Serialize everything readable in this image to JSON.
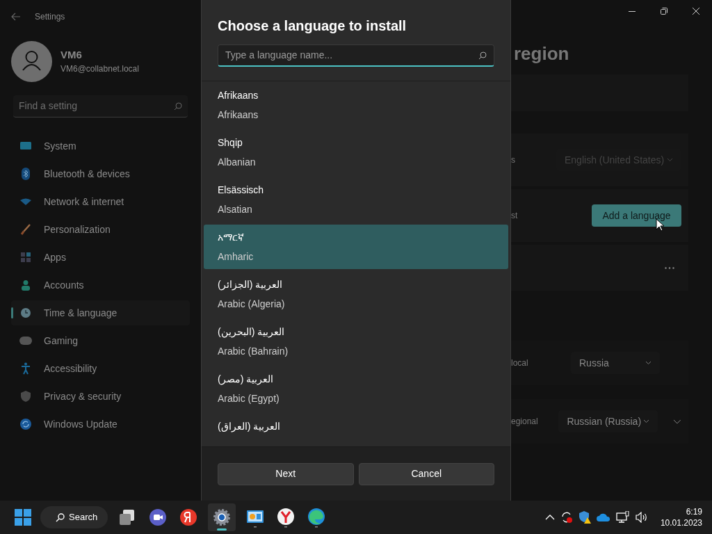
{
  "settings_window": {
    "title": "Settings",
    "user": {
      "name": "VM6",
      "email": "VM6@collabnet.local"
    },
    "search": {
      "placeholder": "Find a setting"
    },
    "sidebar": {
      "items": [
        {
          "label": "System",
          "selected": false
        },
        {
          "label": "Bluetooth & devices",
          "selected": false
        },
        {
          "label": "Network & internet",
          "selected": false
        },
        {
          "label": "Personalization",
          "selected": false
        },
        {
          "label": "Apps",
          "selected": false
        },
        {
          "label": "Accounts",
          "selected": false
        },
        {
          "label": "Time & language",
          "selected": true
        },
        {
          "label": "Gaming",
          "selected": false
        },
        {
          "label": "Accessibility",
          "selected": false
        },
        {
          "label": "Privacy & security",
          "selected": false
        },
        {
          "label": "Windows Update",
          "selected": false
        }
      ]
    },
    "page_title": "region",
    "language_rows": [
      {
        "label": "s",
        "dropdown": "English (United States)",
        "disabled": true
      },
      {
        "label": "st",
        "button": "Add a language"
      }
    ],
    "region_rows": [
      {
        "label": "local",
        "dropdown": "Russia"
      },
      {
        "label": "egional",
        "dropdown": "Russian (Russia)"
      }
    ]
  },
  "dialog": {
    "title": "Choose a language to install",
    "search": {
      "placeholder": "Type a language name..."
    },
    "languages": [
      {
        "native": "Afrikaans",
        "english": "Afrikaans",
        "selected": false
      },
      {
        "native": "Shqip",
        "english": "Albanian",
        "selected": false
      },
      {
        "native": "Elsässisch",
        "english": "Alsatian",
        "selected": false
      },
      {
        "native": "አማርኛ",
        "english": "Amharic",
        "selected": true
      },
      {
        "native": "العربية (الجزائر)",
        "english": "Arabic (Algeria)",
        "selected": false
      },
      {
        "native": "العربية (البحرين)",
        "english": "Arabic (Bahrain)",
        "selected": false
      },
      {
        "native": "العربية (مصر)",
        "english": "Arabic (Egypt)",
        "selected": false
      },
      {
        "native": "العربية (العراق)",
        "selected": false
      }
    ],
    "buttons": [
      "Next",
      "Cancel"
    ]
  },
  "taskbar": {
    "search": "Search",
    "time": "6:19",
    "date": "10.01.2023"
  }
}
